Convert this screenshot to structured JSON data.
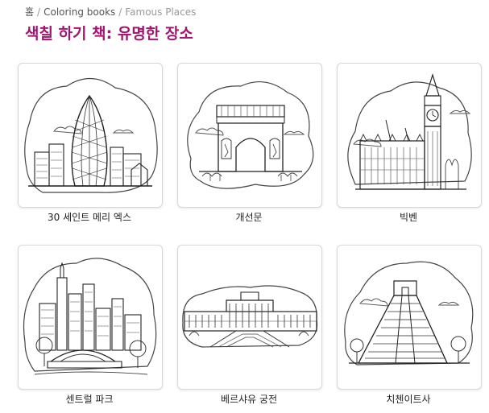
{
  "breadcrumb": {
    "home": "홈",
    "separator": "/",
    "coloring_books": "Coloring books",
    "current": "Famous Places"
  },
  "page_title": "색칠 하기 책: 유명한 장소",
  "cards": [
    {
      "label": "30 세인트 메리 엑스",
      "icon": "gherkin-tower-drawing"
    },
    {
      "label": "개선문",
      "icon": "arc-de-triomphe-drawing"
    },
    {
      "label": "빅벤",
      "icon": "big-ben-drawing"
    },
    {
      "label": "센트럴 파크",
      "icon": "central-park-drawing"
    },
    {
      "label": "베르샤유 궁전",
      "icon": "versailles-palace-drawing"
    },
    {
      "label": "치첸이트사",
      "icon": "chichen-itza-drawing"
    }
  ],
  "colors": {
    "title": "#a0156e",
    "breadcrumb": "#555555",
    "card_border": "#d8d8d8"
  }
}
